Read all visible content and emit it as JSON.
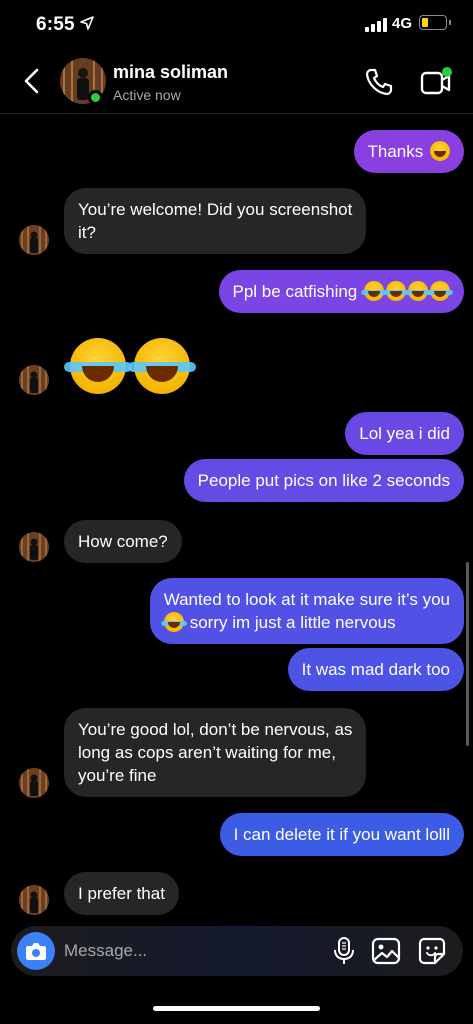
{
  "status_bar": {
    "time": "6:55",
    "network": "4G",
    "battery_level": 0.25
  },
  "header": {
    "name": "mina soliman",
    "status": "Active now"
  },
  "composer": {
    "placeholder": "Message..."
  },
  "messages": [
    {
      "dir": "out",
      "lines": [
        "Thanks"
      ],
      "emoji": [
        "grin"
      ]
    },
    {
      "dir": "in",
      "lines": [
        "You’re welcome! Did you screenshot",
        "it?"
      ]
    },
    {
      "dir": "out",
      "lines": [
        "Ppl be catfishing"
      ],
      "emoji": [
        "joy",
        "joy",
        "joy",
        "joy"
      ]
    },
    {
      "dir": "in",
      "emoji_only": [
        "joy",
        "joy"
      ]
    },
    {
      "dir": "out",
      "lines": [
        "Lol yea i did"
      ]
    },
    {
      "dir": "out",
      "lines": [
        "People put pics on like 2 seconds"
      ]
    },
    {
      "dir": "in",
      "lines": [
        "How come?"
      ]
    },
    {
      "dir": "out",
      "lines": [
        "Wanted to look at it make sure it’s you",
        "sorry im just a little nervous"
      ],
      "emoji": [
        "joy"
      ]
    },
    {
      "dir": "out",
      "lines": [
        "It was mad dark too"
      ]
    },
    {
      "dir": "in",
      "lines": [
        "You’re good lol, don’t be nervous, as",
        "long as cops aren’t waiting for me,",
        "you’re fine"
      ]
    },
    {
      "dir": "out",
      "lines": [
        "I can delete it if you want lolll"
      ]
    },
    {
      "dir": "in",
      "lines": [
        "I prefer that"
      ]
    }
  ],
  "colors": {
    "outgoing_top": "#8a3fe0",
    "outgoing_bottom": "#3d5ce5",
    "incoming": "#262626",
    "online": "#2ecc40"
  }
}
